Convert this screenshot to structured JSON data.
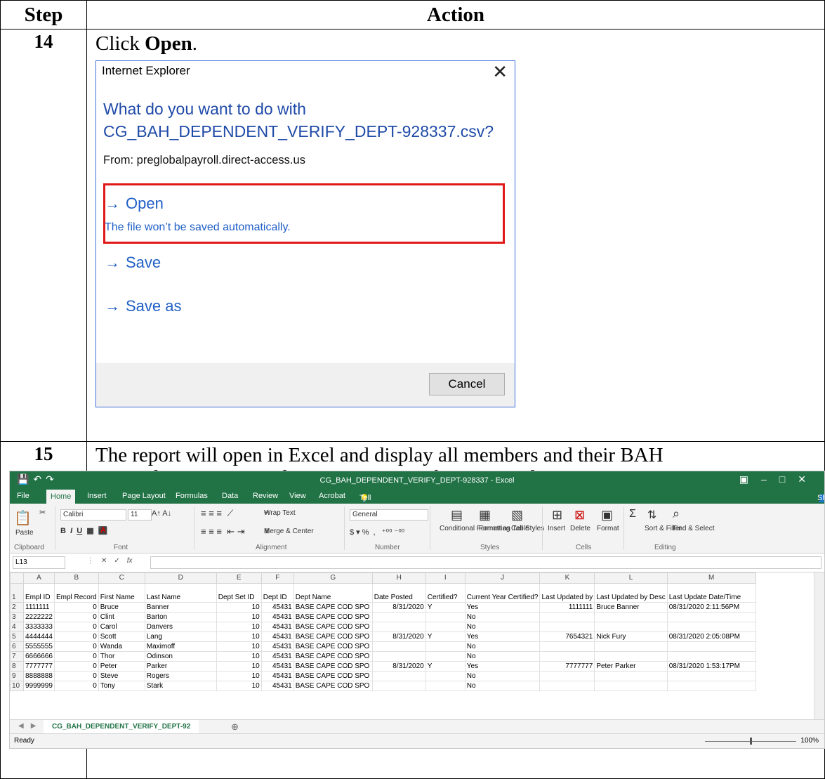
{
  "header": {
    "step": "Step",
    "action": "Action"
  },
  "step14": {
    "number": "14",
    "text_pre": "Click ",
    "text_bold": "Open",
    "text_post": ".",
    "dialog": {
      "title": "Internet Explorer",
      "close": "✕",
      "question_line1": "What do you want to do with",
      "question_line2": "CG_BAH_DEPENDENT_VERIFY_DEPT-928337.csv?",
      "from": "From: preglobalpayroll.direct-access.us",
      "open_label": "Open",
      "open_sub": "The file won’t be saved automatically.",
      "save_label": "Save",
      "save_as_label": "Save as",
      "cancel_label": "Cancel",
      "arrow": "→"
    }
  },
  "step15": {
    "number": "15",
    "text_line1": "The report will open in Excel and display all members and their BAH",
    "text_line2": "Dependency Data Verification responses for a particular Dept ID.",
    "excel": {
      "title": "CG_BAH_DEPENDENT_VERIFY_DEPT-928337 - Excel",
      "tabs": [
        "File",
        "Home",
        "Insert",
        "Page Layout",
        "Formulas",
        "Data",
        "Review",
        "View",
        "Acrobat",
        "Tell me what you want to do..."
      ],
      "share": "Share",
      "ribbon": {
        "paste": "Paste",
        "font": "Calibri",
        "size": "11",
        "wrap": "Wrap Text",
        "merge": "Merge & Center",
        "numfmt": "General",
        "conditional": "Conditional Formatting",
        "format_table": "Format as Table",
        "cell_styles": "Cell Styles",
        "insert": "Insert",
        "delete": "Delete",
        "format": "Format",
        "sort": "Sort & Filter",
        "find": "Find & Select",
        "groups": [
          "Clipboard",
          "Font",
          "Alignment",
          "Number",
          "Styles",
          "Cells",
          "Editing"
        ]
      },
      "name_box": "L13",
      "fx": "fx",
      "columns": [
        "A",
        "B",
        "C",
        "D",
        "E",
        "F",
        "G",
        "H",
        "I",
        "J",
        "K",
        "L",
        "M"
      ],
      "headers": [
        "Empl ID",
        "Empl Record",
        "First Name",
        "Last Name",
        "Dept Set ID",
        "Dept ID",
        "Dept Name",
        "Date Posted",
        "Certified?",
        "Current Year Certified?",
        "Last Updated by",
        "Last Updated by Desc",
        "Last Update Date/Time"
      ],
      "rows": [
        [
          "1111111",
          "0",
          "Bruce",
          "Banner",
          "10",
          "45431",
          "BASE CAPE COD SPO",
          "8/31/2020",
          "Y",
          "Yes",
          "1111111",
          "Bruce Banner",
          "08/31/2020  2:11:56PM"
        ],
        [
          "2222222",
          "0",
          "Clint",
          "Barton",
          "10",
          "45431",
          "BASE CAPE COD SPO",
          "",
          "",
          "No",
          "",
          "",
          ""
        ],
        [
          "3333333",
          "0",
          "Carol",
          "Danvers",
          "10",
          "45431",
          "BASE CAPE COD SPO",
          "",
          "",
          "No",
          "",
          "",
          ""
        ],
        [
          "4444444",
          "0",
          "Scott",
          "Lang",
          "10",
          "45431",
          "BASE CAPE COD SPO",
          "8/31/2020",
          "Y",
          "Yes",
          "7654321",
          "Nick Fury",
          "08/31/2020  2:05:08PM"
        ],
        [
          "5555555",
          "0",
          "Wanda",
          "Maximoff",
          "10",
          "45431",
          "BASE CAPE COD SPO",
          "",
          "",
          "No",
          "",
          "",
          ""
        ],
        [
          "6666666",
          "0",
          "Thor",
          "Odinson",
          "10",
          "45431",
          "BASE CAPE COD SPO",
          "",
          "",
          "No",
          "",
          "",
          ""
        ],
        [
          "7777777",
          "0",
          "Peter",
          "Parker",
          "10",
          "45431",
          "BASE CAPE COD SPO",
          "8/31/2020",
          "Y",
          "Yes",
          "7777777",
          "Peter Parker",
          "08/31/2020  1:53:17PM"
        ],
        [
          "8888888",
          "0",
          "Steve",
          "Rogers",
          "10",
          "45431",
          "BASE CAPE COD SPO",
          "",
          "",
          "No",
          "",
          "",
          ""
        ],
        [
          "9999999",
          "0",
          "Tony",
          "Stark",
          "10",
          "45431",
          "BASE CAPE COD SPO",
          "",
          "",
          "No",
          "",
          "",
          ""
        ]
      ],
      "sheet_tab": "CG_BAH_DEPENDENT_VERIFY_DEPT-92",
      "status": "Ready",
      "zoom": "100%"
    }
  }
}
